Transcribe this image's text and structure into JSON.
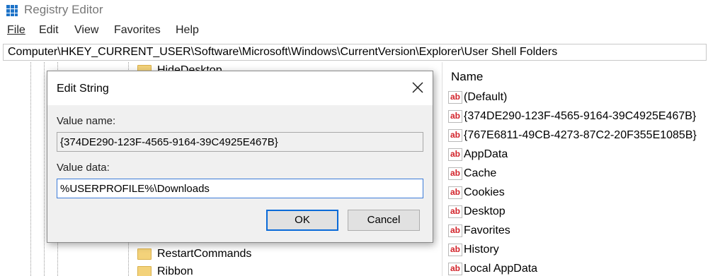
{
  "window": {
    "title": "Registry Editor"
  },
  "menu": [
    "File",
    "Edit",
    "View",
    "Favorites",
    "Help"
  ],
  "address": "Computer\\HKEY_CURRENT_USER\\Software\\Microsoft\\Windows\\CurrentVersion\\Explorer\\User Shell Folders",
  "tree": {
    "visible_items": [
      "HideDesktop",
      "RestartCommands",
      "Ribbon"
    ]
  },
  "list": {
    "column_header": "Name",
    "rows": [
      "(Default)",
      "{374DE290-123F-4565-9164-39C4925E467B}",
      "{767E6811-49CB-4273-87C2-20F355E1085B}",
      "AppData",
      "Cache",
      "Cookies",
      "Desktop",
      "Favorites",
      "History",
      "Local AppData"
    ],
    "icon_text": "ab"
  },
  "dialog": {
    "title": "Edit String",
    "value_name_label": "Value name:",
    "value_name": "{374DE290-123F-4565-9164-39C4925E467B}",
    "value_data_label": "Value data:",
    "value_data": "%USERPROFILE%\\Downloads",
    "ok_label": "OK",
    "cancel_label": "Cancel"
  },
  "colors": {
    "folder": "#f3d27a",
    "accent": "#0a6ad8",
    "ab_icon": "#d2232a"
  }
}
